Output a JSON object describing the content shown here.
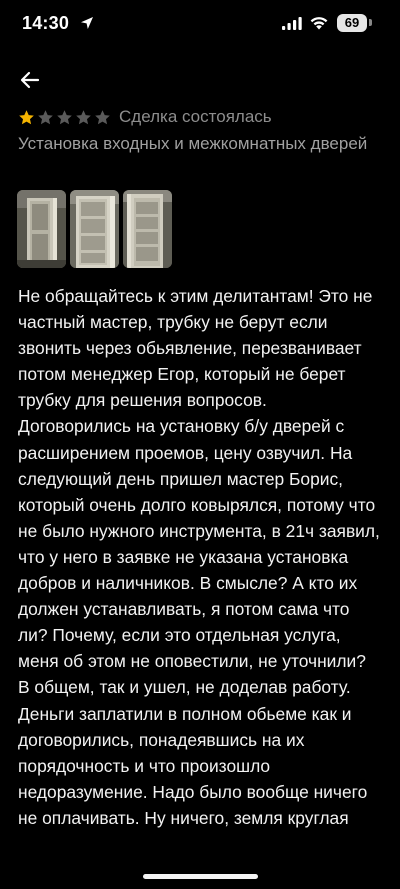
{
  "status_bar": {
    "time": "14:30",
    "battery": "69"
  },
  "rating": {
    "value": 1,
    "max": 5,
    "filled_color": "#f5b400",
    "empty_color": "#5a5a5a"
  },
  "deal_status": "Сделка состоялась",
  "service_title": "Установка входных и межкомнатных дверей",
  "photos": [
    {
      "icon": "door-photo"
    },
    {
      "icon": "door-photo"
    },
    {
      "icon": "door-photo"
    }
  ],
  "review_text": "Не обращайтесь к этим делитантам! Это не частный мастер, трубку не берут если звонить через обьявление, перезванивает потом менеджер Егор, который не берет трубку для решения вопросов. Договорились на установку б/у дверей с расширением проемов, цену озвучил. На следующий день пришел мастер Борис, который очень долго ковырялся, потому что не было нужного инструмента, в 21ч заявил, что у него в заявке не указана установка добров и наличников. В смысле? А кто их должен устанавливать, я потом сама что ли? Почему, если это отдельная услуга, меня об этом не оповестили, не уточнили? В общем, так и ушел, не доделав работу. Деньги заплатили в полном обьеме как и договорились, понадеявшись на их порядочность и что произошло недоразумение. Надо было вообще ничего не оплачивать. Ну ничего, земля круглая"
}
